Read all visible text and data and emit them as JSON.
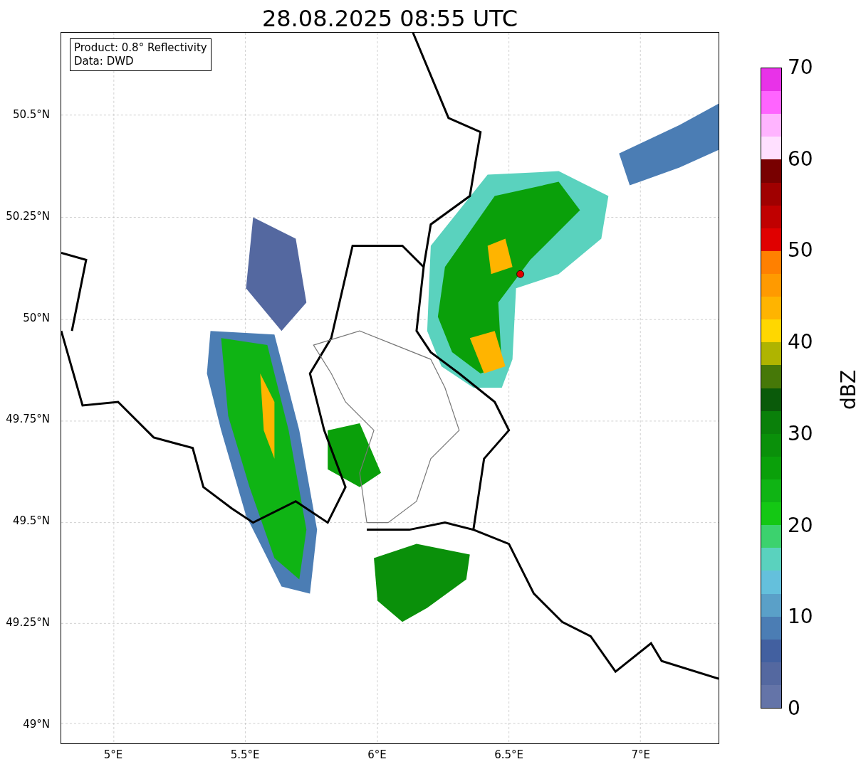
{
  "title": "28.08.2025 08:55 UTC",
  "legend": [
    "Product: 0.8° Reflectivity",
    "Data: DWD"
  ],
  "lat_ticks": [
    "50.5°N",
    "50.25°N",
    "50°N",
    "49.75°N",
    "49.5°N",
    "49.25°N",
    "49°N"
  ],
  "lon_ticks": [
    "5°E",
    "5.5°E",
    "6°E",
    "6.5°E",
    "7°E"
  ],
  "map": {
    "kind": "map-picture"
  },
  "colorbar": {
    "ticks": [
      "70",
      "60",
      "50",
      "40",
      "30",
      "20",
      "10",
      "0"
    ],
    "label": "dBZ",
    "segments": [
      {
        "color": "#e832e8"
      },
      {
        "color": "#ff64ff"
      },
      {
        "color": "#ffb4ff"
      },
      {
        "color": "#ffe0ff"
      },
      {
        "color": "#780000"
      },
      {
        "color": "#a00000"
      },
      {
        "color": "#c00000"
      },
      {
        "color": "#e00000"
      },
      {
        "color": "#ff8000"
      },
      {
        "color": "#ff9a00"
      },
      {
        "color": "#ffb400"
      },
      {
        "color": "#ffd700"
      },
      {
        "color": "#afb400"
      },
      {
        "color": "#467808"
      },
      {
        "color": "#0a5a0a"
      },
      {
        "color": "#0a800a"
      },
      {
        "color": "#0a900a"
      },
      {
        "color": "#0aa00a"
      },
      {
        "color": "#0fb414"
      },
      {
        "color": "#14c814"
      },
      {
        "color": "#3cd26e"
      },
      {
        "color": "#5ad2be"
      },
      {
        "color": "#64c0dc"
      },
      {
        "color": "#5aa0c8"
      },
      {
        "color": "#4b7db4"
      },
      {
        "color": "#4260a0"
      },
      {
        "color": "#5468a0"
      },
      {
        "color": "#6474a8"
      }
    ]
  }
}
